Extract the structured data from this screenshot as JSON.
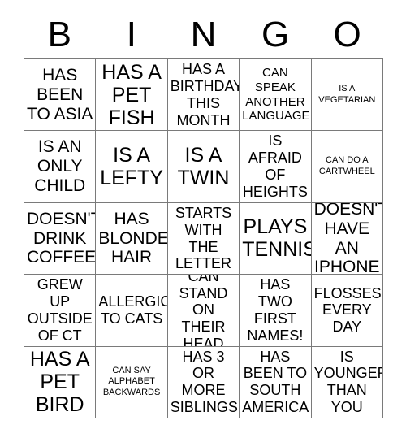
{
  "card": {
    "title": "BINGO",
    "header_letters": [
      "B",
      "I",
      "N",
      "G",
      "O"
    ],
    "columns": 5,
    "rows": 5,
    "colors": {
      "background": "#ffffff",
      "text": "#000000",
      "grid_line": "#7a7a7a"
    },
    "cells": [
      {
        "text": "HAS\nBEEN\nTO ASIA",
        "size": "lg"
      },
      {
        "text": "HAS A\nPET\nFISH",
        "size": "xl"
      },
      {
        "text": "HAS A\nBIRTHDAY\nTHIS\nMONTH",
        "size": "md"
      },
      {
        "text": "CAN\nSPEAK\nANOTHER\nLANGUAGE",
        "size": "sm"
      },
      {
        "text": "IS A\nVEGETARIAN",
        "size": "xs"
      },
      {
        "text": "IS AN\nONLY\nCHILD",
        "size": "lg"
      },
      {
        "text": "IS A\nLEFTY",
        "size": "xl"
      },
      {
        "text": "IS A\nTWIN",
        "size": "xl"
      },
      {
        "text": "IS\nAFRAID\nOF\nHEIGHTS",
        "size": "md"
      },
      {
        "text": "CAN DO A\nCARTWHEEL",
        "size": "xs"
      },
      {
        "text": "DOESN'T\nDRINK\nCOFFEE",
        "size": "lg"
      },
      {
        "text": "HAS\nBLONDE\nHAIR",
        "size": "lg"
      },
      {
        "text": "NAME\nSTARTS\nWITH THE\nLETTER S",
        "size": "md"
      },
      {
        "text": "PLAYS\nTENNIS",
        "size": "xl"
      },
      {
        "text": "DOESN'T\nHAVE AN\nIPHONE",
        "size": "lg"
      },
      {
        "text": "GREW\nUP\nOUTSIDE\nOF CT",
        "size": "md"
      },
      {
        "text": "ALLERGIC\nTO CATS",
        "size": "md"
      },
      {
        "text": "CAN\nSTAND\nON THEIR\nHEAD",
        "size": "md"
      },
      {
        "text": "HAS TWO\nFIRST\nNAMES!",
        "size": "md"
      },
      {
        "text": "FLOSSES\nEVERY\nDAY",
        "size": "md"
      },
      {
        "text": "HAS A\nPET\nBIRD",
        "size": "xl"
      },
      {
        "text": "CAN SAY\nALPHABET\nBACKWARDS",
        "size": "xs"
      },
      {
        "text": "HAS 3\nOR\nMORE\nSIBLINGS",
        "size": "md"
      },
      {
        "text": "HAS\nBEEN TO\nSOUTH\nAMERICA",
        "size": "md"
      },
      {
        "text": "IS\nYOUNGER\nTHAN YOU",
        "size": "md"
      }
    ]
  }
}
